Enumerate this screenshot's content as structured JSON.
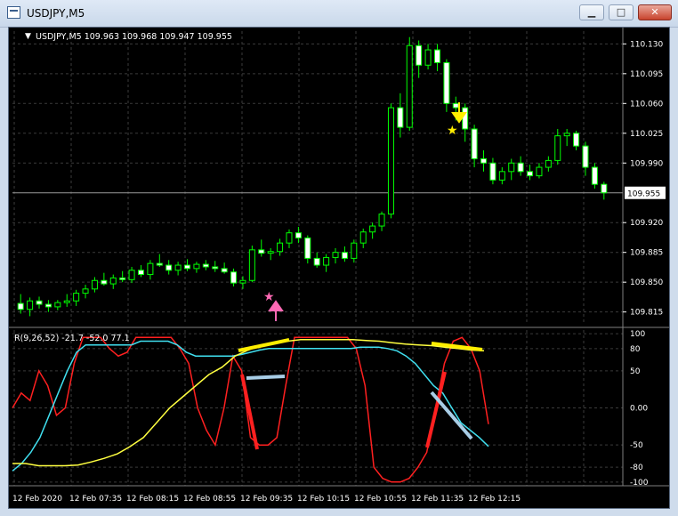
{
  "window": {
    "title": "USDJPY,M5",
    "minimize_glyph": "▁",
    "maximize_glyph": "□",
    "close_glyph": "✕"
  },
  "price_panel": {
    "header": "USDJPY,M5  109.963 109.968 109.947 109.955",
    "price_ticks": [
      "110.130",
      "110.095",
      "110.060",
      "110.025",
      "109.990",
      "109.920",
      "109.885",
      "109.850",
      "109.815"
    ],
    "current_price": "109.955"
  },
  "indicator_panel": {
    "header": "R(9,26,52) -21.7 -52.0 77.1",
    "ticks": [
      "100",
      "80",
      "50",
      "0.00",
      "-50",
      "-80",
      "-100"
    ]
  },
  "time_labels": [
    "12 Feb 2020",
    "12 Feb 07:35",
    "12 Feb 08:15",
    "12 Feb 08:55",
    "12 Feb 09:35",
    "12 Feb 10:15",
    "12 Feb 10:55",
    "12 Feb 11:35",
    "12 Feb 12:15"
  ],
  "colors": {
    "background": "#000000",
    "bull": "#ffffff",
    "bear": "#00ff00",
    "grid": "#3b3b3b",
    "red_line": "#ff2020",
    "cyan_line": "#40e0f0",
    "yellow_line": "#ffff40",
    "buy_arrow": "#ff69b4",
    "sell_arrow": "#ffee00"
  },
  "markers": {
    "buy_icon": "up-arrow-icon",
    "sell_icon": "down-arrow-icon",
    "star_icon": "star-icon"
  },
  "chart_data": [
    {
      "type": "candlestick",
      "title": "USDJPY,M5",
      "ylim": [
        109.8,
        110.145
      ],
      "candles": [
        [
          109.825,
          109.836,
          109.813,
          109.818
        ],
        [
          109.818,
          109.832,
          109.81,
          109.828
        ],
        [
          109.828,
          109.833,
          109.819,
          109.824
        ],
        [
          109.824,
          109.829,
          109.815,
          109.821
        ],
        [
          109.821,
          109.829,
          109.817,
          109.826
        ],
        [
          109.826,
          109.836,
          109.821,
          109.828
        ],
        [
          109.828,
          109.841,
          109.822,
          109.837
        ],
        [
          109.837,
          109.847,
          109.831,
          109.842
        ],
        [
          109.842,
          109.856,
          109.838,
          109.852
        ],
        [
          109.852,
          109.861,
          109.846,
          109.848
        ],
        [
          109.848,
          109.859,
          109.842,
          109.855
        ],
        [
          109.855,
          109.863,
          109.85,
          109.853
        ],
        [
          109.853,
          109.868,
          109.849,
          109.864
        ],
        [
          109.864,
          109.87,
          109.856,
          109.859
        ],
        [
          109.859,
          109.876,
          109.853,
          109.872
        ],
        [
          109.872,
          109.883,
          109.868,
          109.87
        ],
        [
          109.87,
          109.876,
          109.859,
          109.864
        ],
        [
          109.864,
          109.874,
          109.858,
          109.87
        ],
        [
          109.87,
          109.877,
          109.863,
          109.866
        ],
        [
          109.866,
          109.874,
          109.861,
          109.871
        ],
        [
          109.871,
          109.876,
          109.864,
          109.868
        ],
        [
          109.868,
          109.875,
          109.862,
          109.866
        ],
        [
          109.866,
          109.873,
          109.86,
          109.862
        ],
        [
          109.862,
          109.866,
          109.845,
          109.849
        ],
        [
          109.849,
          109.857,
          109.842,
          109.852
        ],
        [
          109.852,
          109.893,
          109.85,
          109.888
        ],
        [
          109.888,
          109.9,
          109.88,
          109.884
        ],
        [
          109.884,
          109.89,
          109.876,
          109.886
        ],
        [
          109.886,
          109.901,
          109.881,
          109.896
        ],
        [
          109.896,
          109.912,
          109.89,
          109.908
        ],
        [
          109.908,
          109.915,
          109.896,
          109.902
        ],
        [
          109.902,
          109.905,
          109.872,
          109.878
        ],
        [
          109.878,
          109.885,
          109.867,
          109.87
        ],
        [
          109.87,
          109.883,
          109.862,
          109.879
        ],
        [
          109.879,
          109.89,
          109.872,
          109.885
        ],
        [
          109.885,
          109.892,
          109.874,
          109.878
        ],
        [
          109.878,
          109.9,
          109.873,
          109.896
        ],
        [
          109.896,
          109.913,
          109.89,
          109.909
        ],
        [
          109.909,
          109.92,
          109.901,
          109.916
        ],
        [
          109.916,
          109.933,
          109.91,
          109.93
        ],
        [
          109.93,
          110.06,
          109.925,
          110.055
        ],
        [
          110.055,
          110.072,
          110.02,
          110.032
        ],
        [
          110.032,
          110.138,
          110.028,
          110.128
        ],
        [
          110.128,
          110.134,
          110.09,
          110.105
        ],
        [
          110.105,
          110.13,
          110.1,
          110.123
        ],
        [
          110.123,
          110.13,
          110.098,
          110.108
        ],
        [
          110.108,
          110.112,
          110.05,
          110.06
        ],
        [
          110.06,
          110.068,
          110.04,
          110.055
        ],
        [
          110.055,
          110.06,
          110.015,
          110.03
        ],
        [
          110.03,
          110.035,
          109.985,
          109.995
        ],
        [
          109.995,
          110.005,
          109.98,
          109.99
        ],
        [
          109.99,
          109.996,
          109.965,
          109.97
        ],
        [
          109.97,
          109.985,
          109.965,
          109.98
        ],
        [
          109.98,
          109.995,
          109.97,
          109.99
        ],
        [
          109.99,
          109.998,
          109.975,
          109.98
        ],
        [
          109.98,
          109.988,
          109.97,
          109.975
        ],
        [
          109.975,
          109.99,
          109.972,
          109.985
        ],
        [
          109.985,
          109.998,
          109.98,
          109.993
        ],
        [
          109.993,
          110.03,
          109.988,
          110.022
        ],
        [
          110.022,
          110.03,
          110.01,
          110.025
        ],
        [
          110.025,
          110.028,
          110.005,
          110.01
        ],
        [
          110.01,
          110.015,
          109.975,
          109.985
        ],
        [
          109.985,
          109.99,
          109.96,
          109.965
        ],
        [
          109.965,
          109.968,
          109.947,
          109.955
        ]
      ]
    },
    {
      "type": "line",
      "title": "R(9,26,52)",
      "ylim": [
        -105,
        105
      ],
      "series": [
        {
          "name": "-21.7",
          "color": "#ff2020",
          "values": [
            0,
            20,
            10,
            50,
            30,
            -10,
            0,
            60,
            95,
            95,
            95,
            80,
            70,
            75,
            95,
            95,
            95,
            95,
            95,
            80,
            60,
            0,
            -30,
            -50,
            0,
            70,
            50,
            -40,
            -50,
            -50,
            -40,
            30,
            95,
            95,
            95,
            95,
            95,
            95,
            95,
            80,
            30,
            -80,
            -95,
            -100,
            -100,
            -95,
            -80,
            -60,
            0,
            60,
            90,
            95,
            80,
            50,
            -22
          ]
        },
        {
          "name": "-52.0",
          "color": "#40e0f0",
          "values": [
            -85,
            -75,
            -60,
            -40,
            -10,
            20,
            50,
            75,
            85,
            85,
            85,
            85,
            85,
            85,
            90,
            90,
            90,
            90,
            85,
            75,
            70,
            70,
            70,
            70,
            70,
            72,
            75,
            78,
            80,
            80,
            80,
            80,
            80,
            80,
            80,
            80,
            80,
            80,
            82,
            82,
            82,
            80,
            77,
            70,
            60,
            45,
            30,
            20,
            0,
            -20,
            -30,
            -40,
            -52
          ]
        },
        {
          "name": "77.1",
          "color": "#ffff40",
          "values": [
            -75,
            -75,
            -78,
            -78,
            -78,
            -77,
            -73,
            -68,
            -62,
            -52,
            -40,
            -20,
            0,
            15,
            30,
            45,
            55,
            70,
            78,
            85,
            88,
            90,
            92,
            92,
            92,
            92,
            92,
            91,
            90,
            88,
            86,
            85,
            84,
            82,
            80,
            78,
            77
          ]
        }
      ]
    }
  ]
}
